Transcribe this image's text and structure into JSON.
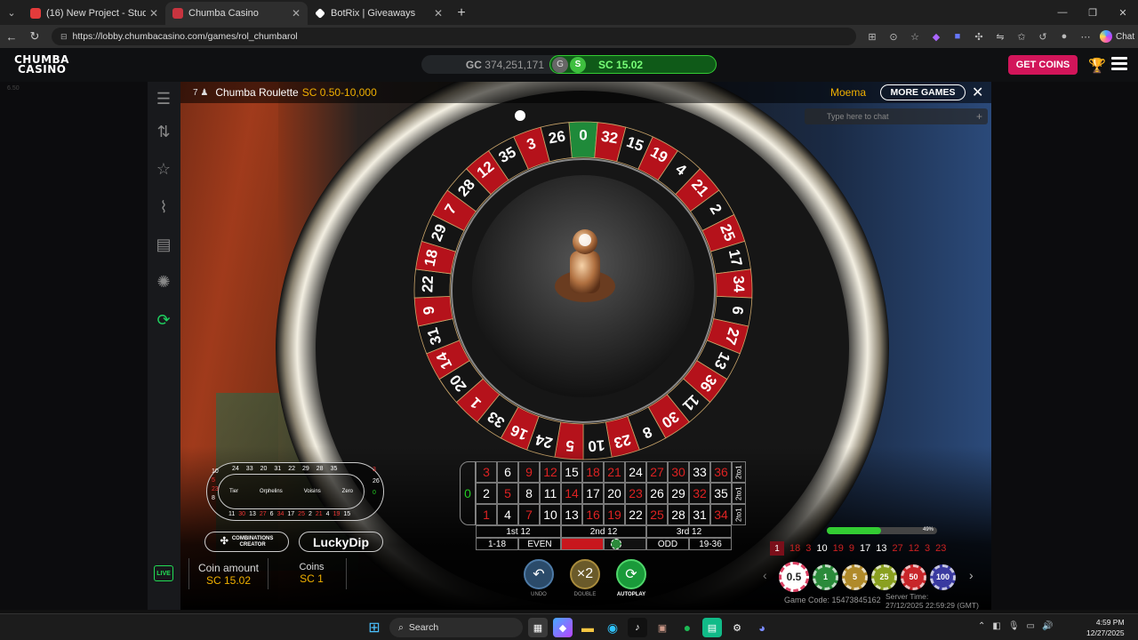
{
  "browser": {
    "tabs": [
      {
        "title": "(16) New Project - Studio",
        "color": "#e33b3b"
      },
      {
        "title": "Chumba Casino",
        "color": "#c8343f"
      },
      {
        "title": "BotRix | Giveaways",
        "color": "#ffffff"
      }
    ],
    "url": "https://lobby.chumbacasino.com/games/rol_chumbarol",
    "chat_label": "Chat"
  },
  "site": {
    "logo_line1": "CHUMBA",
    "logo_line2": "CASINO",
    "gc_label": "GC",
    "gc_value": "374,251,171",
    "g_badge": "G",
    "s_badge": "S",
    "sc_label": "SC",
    "sc_value": "15.02",
    "get_coins": "GET COINS"
  },
  "game": {
    "version": "6.50",
    "players": "7",
    "name": "Chumba Roulette",
    "limits": "SC 0.50-10,000",
    "dealer": "Moema",
    "more_games": "MORE GAMES",
    "chat_placeholder": "Type here to chat",
    "wheel_numbers": [
      "0",
      "32",
      "15",
      "19",
      "4",
      "21",
      "2",
      "25",
      "17",
      "34",
      "6",
      "27",
      "13",
      "36",
      "11",
      "30",
      "8",
      "23",
      "10",
      "5",
      "24",
      "16",
      "33",
      "1",
      "20",
      "14",
      "31",
      "9",
      "22",
      "18",
      "29",
      "7",
      "28",
      "12",
      "35",
      "3",
      "26"
    ],
    "racetrack": {
      "top": [
        "24",
        "33",
        "20",
        "31",
        "22",
        "29",
        "28",
        "35"
      ],
      "bottom": [
        "11",
        "30",
        "13",
        "27",
        "6",
        "34",
        "17",
        "25",
        "2",
        "21",
        "4",
        "19",
        "15"
      ],
      "left": [
        "10",
        "5",
        "23",
        "8"
      ],
      "right": [
        "3",
        "26",
        "0"
      ],
      "sections": [
        "Tier",
        "Orphelins",
        "Voisins",
        "Zero"
      ]
    },
    "combinations_line1": "COMBINATIONS",
    "combinations_line2": "CREATOR",
    "lucky_dip": "LuckyDip",
    "coin_amount_label": "Coin amount",
    "coin_amount_value": "SC 15.02",
    "coins_label": "Coins",
    "coins_value": "SC 1",
    "live": "LIVE",
    "grid": {
      "zero": "0",
      "rows": [
        [
          "3",
          "6",
          "9",
          "12",
          "15",
          "18",
          "21",
          "24",
          "27",
          "30",
          "33",
          "36"
        ],
        [
          "2",
          "5",
          "8",
          "11",
          "14",
          "17",
          "20",
          "23",
          "26",
          "29",
          "32",
          "35"
        ],
        [
          "1",
          "4",
          "7",
          "10",
          "13",
          "16",
          "19",
          "22",
          "25",
          "28",
          "31",
          "34"
        ]
      ],
      "red": [
        "3",
        "9",
        "12",
        "18",
        "21",
        "27",
        "30",
        "36",
        "5",
        "14",
        "23",
        "32",
        "1",
        "7",
        "16",
        "19",
        "25",
        "34"
      ],
      "columns": [
        "2to1",
        "2to1",
        "2to1"
      ],
      "dozens": [
        "1st 12",
        "2nd 12",
        "3rd 12"
      ],
      "evens": [
        "1-18",
        "EVEN",
        "",
        "",
        "ODD",
        "19-36"
      ]
    },
    "controls": {
      "undo": "UNDO",
      "double": "DOUBLE",
      "double_symbol": "×2",
      "autoplay": "AUTOPLAY"
    },
    "progress_pct": "49%",
    "progress_value": 0.49,
    "history": [
      {
        "n": "1",
        "c": "red"
      },
      {
        "n": "18",
        "c": "red"
      },
      {
        "n": "3",
        "c": "red"
      },
      {
        "n": "10",
        "c": "white"
      },
      {
        "n": "19",
        "c": "red"
      },
      {
        "n": "9",
        "c": "red"
      },
      {
        "n": "17",
        "c": "white"
      },
      {
        "n": "13",
        "c": "white"
      },
      {
        "n": "27",
        "c": "red"
      },
      {
        "n": "12",
        "c": "red"
      },
      {
        "n": "3",
        "c": "red"
      },
      {
        "n": "23",
        "c": "red"
      }
    ],
    "chips": [
      "0.5",
      "1",
      "5",
      "25",
      "50",
      "100"
    ],
    "game_code": "Game Code: 15473845162",
    "server_time_label": "Server Time:",
    "server_time": "27/12/2025 22:59:29 (GMT)"
  },
  "taskbar": {
    "search": "Search",
    "time": "4:59 PM",
    "date": "12/27/2025"
  }
}
